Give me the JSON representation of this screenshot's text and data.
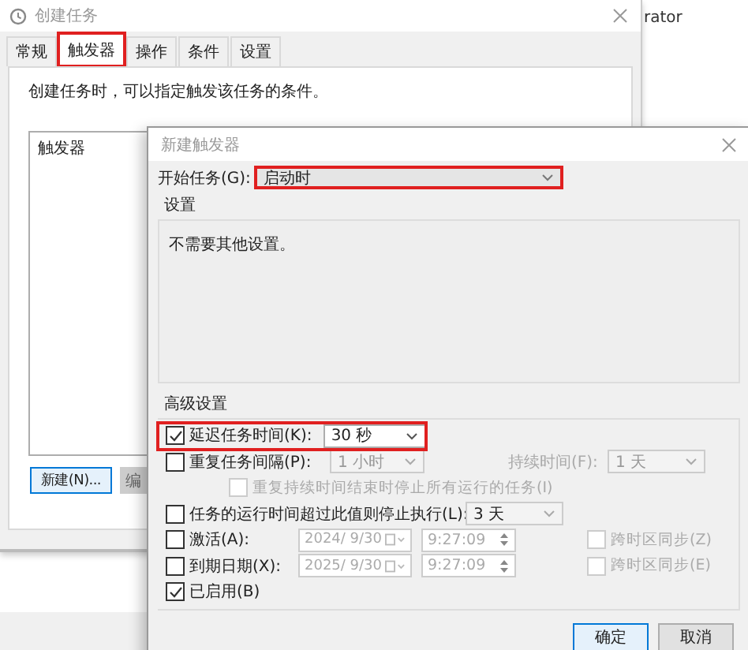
{
  "background_window": {
    "title_fragment": "rator"
  },
  "main_window": {
    "title": "创建任务",
    "tabs": [
      {
        "label": "常规",
        "selected": false,
        "highlighted": false
      },
      {
        "label": "触发器",
        "selected": true,
        "highlighted": true
      },
      {
        "label": "操作",
        "selected": false,
        "highlighted": false
      },
      {
        "label": "条件",
        "selected": false,
        "highlighted": false
      },
      {
        "label": "设置",
        "selected": false,
        "highlighted": false
      }
    ],
    "description": "创建任务时，可以指定触发该任务的条件。",
    "trigger_list": {
      "header": "触发器"
    },
    "buttons": [
      {
        "label": "新建(N)...",
        "default": true
      },
      {
        "label": "编",
        "default": false
      }
    ]
  },
  "dialog": {
    "title": "新建触发器",
    "begin_task": {
      "label": "开始任务(G):",
      "value": "启动时",
      "highlighted": true
    },
    "settings_group": {
      "title": "设置",
      "text": "不需要其他设置。"
    },
    "advanced": {
      "title": "高级设置",
      "delay": {
        "label": "延迟任务时间(K):",
        "checked": true,
        "value": "30 秒",
        "value_disabled": false,
        "highlighted": true
      },
      "repeat": {
        "label": "重复任务间隔(P):",
        "checked": false,
        "value": "1 小时",
        "value_disabled": true,
        "duration_label": "持续时间(F):",
        "duration_value": "1 天"
      },
      "stop_all": {
        "label": "重复持续时间结束时停止所有运行的任务(I)",
        "checked": false,
        "disabled": true
      },
      "stop_after": {
        "label": "任务的运行时间超过此值则停止执行(L):",
        "checked": false,
        "value": "3 天",
        "value_disabled": false
      },
      "activate": {
        "label": "激活(A):",
        "checked": false,
        "date": "2024/ 9/30",
        "time": "9:27:09",
        "fields_disabled": true,
        "sync_label": "跨时区同步(Z)",
        "sync_checked": false,
        "sync_disabled": true
      },
      "expire": {
        "label": "到期日期(X):",
        "checked": false,
        "date": "2025/ 9/30",
        "time": "9:27:09",
        "fields_disabled": true,
        "sync_label": "跨时区同步(E)",
        "sync_checked": false,
        "sync_disabled": true
      },
      "enabled": {
        "label": "已启用(B)",
        "checked": true
      }
    },
    "buttons": [
      {
        "label": "确定",
        "default": true
      },
      {
        "label": "取消",
        "default": false
      }
    ]
  }
}
